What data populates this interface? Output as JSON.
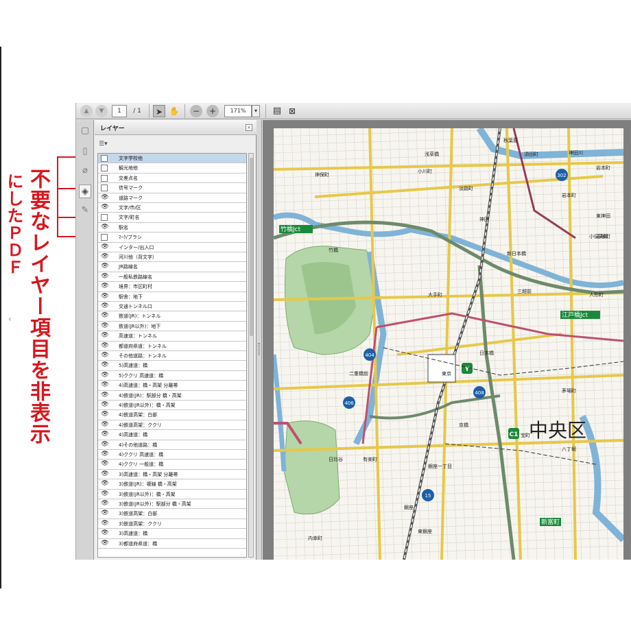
{
  "annotation": {
    "line1": "不要なレイヤー項目を非表示",
    "line2": "にしたＰＤＦ"
  },
  "toolbar": {
    "page_current": "1",
    "page_total": "/ 1",
    "zoom": "171%"
  },
  "panel": {
    "title": "レイヤー",
    "layers": [
      {
        "name": "文字学校他",
        "visible": false,
        "selected": true
      },
      {
        "name": "観光地他",
        "visible": false
      },
      {
        "name": "交差点名",
        "visible": false
      },
      {
        "name": "信号マーク",
        "visible": false
      },
      {
        "name": "道路マーク",
        "visible": true
      },
      {
        "name": "文字/市/区",
        "visible": true
      },
      {
        "name": "文字/町名",
        "visible": false
      },
      {
        "name": "駅名",
        "visible": true
      },
      {
        "name": "ﾏｰｸ/ブラシ",
        "visible": false
      },
      {
        "name": "インター/出入口",
        "visible": true
      },
      {
        "name": "河川他（背文字）",
        "visible": true
      },
      {
        "name": "JR路線名",
        "visible": true
      },
      {
        "name": "一般私鉄路線名",
        "visible": true
      },
      {
        "name": "境界：市区町村",
        "visible": true
      },
      {
        "name": "駅舎：地下",
        "visible": true
      },
      {
        "name": "交通トンネル口",
        "visible": true
      },
      {
        "name": "鉄道(JR)：トンネル",
        "visible": true
      },
      {
        "name": "鉄道(JR以外)：地下",
        "visible": true
      },
      {
        "name": "高速道：トンネル",
        "visible": true
      },
      {
        "name": "都道府県道：トンネル",
        "visible": true
      },
      {
        "name": "その他道路：トンネル",
        "visible": true
      },
      {
        "name": "5)高速道：橋",
        "visible": true
      },
      {
        "name": "5)ククリ 高速道：橋",
        "visible": true
      },
      {
        "name": "4)高速道：橋・高架 分離帯",
        "visible": true
      },
      {
        "name": "4)鉄道(JR)：駅部分 橋・高架",
        "visible": true
      },
      {
        "name": "4)鉄道(JR以外)：橋・高架",
        "visible": true
      },
      {
        "name": "4)鉄道高架：白部",
        "visible": true
      },
      {
        "name": "4)鉄道高架：ククリ",
        "visible": true
      },
      {
        "name": "4)高速道：橋",
        "visible": true
      },
      {
        "name": "4)その他道路：橋",
        "visible": true
      },
      {
        "name": "4)ククリ 高速道：橋",
        "visible": true
      },
      {
        "name": "4)ククリ 一般道：橋",
        "visible": true
      },
      {
        "name": "3)高速道：橋・高架 分離帯",
        "visible": true
      },
      {
        "name": "3)鉄道(JR)：複線 橋・高架",
        "visible": true
      },
      {
        "name": "3)鉄道(JR以外)：橋・高架",
        "visible": true
      },
      {
        "name": "3)鉄道(JR以外)：駅部分 橋・高架",
        "visible": true
      },
      {
        "name": "3)鉄道高架：白部",
        "visible": true
      },
      {
        "name": "3)鉄道高架：ククリ",
        "visible": true
      },
      {
        "name": "3)高速道：橋",
        "visible": true
      },
      {
        "name": "3)都道府県道：橋",
        "visible": true
      }
    ]
  },
  "map": {
    "ward": "中央区",
    "labels": [
      "秋葉原",
      "神田川",
      "岩本町",
      "浅草橋",
      "須田町",
      "小川町",
      "神保町",
      "淡路町",
      "岩本町",
      "神田",
      "東神田",
      "竹橋Jct",
      "馬喰町",
      "小伝馬町",
      "竹橋",
      "新日本橋",
      "三越前",
      "大手町",
      "人形町",
      "江戸橋Jct",
      "日本橋",
      "二重橋前",
      "東京",
      "茅場町",
      "京橋",
      "宝町",
      "八丁堀",
      "日比谷",
      "有楽町",
      "銀座一丁目",
      "新富町",
      "銀座",
      "東銀座",
      "内幸町"
    ],
    "route_shields": [
      "302",
      "404",
      "406",
      "408",
      "15"
    ],
    "station_badges": [
      "Y",
      "C1"
    ]
  }
}
